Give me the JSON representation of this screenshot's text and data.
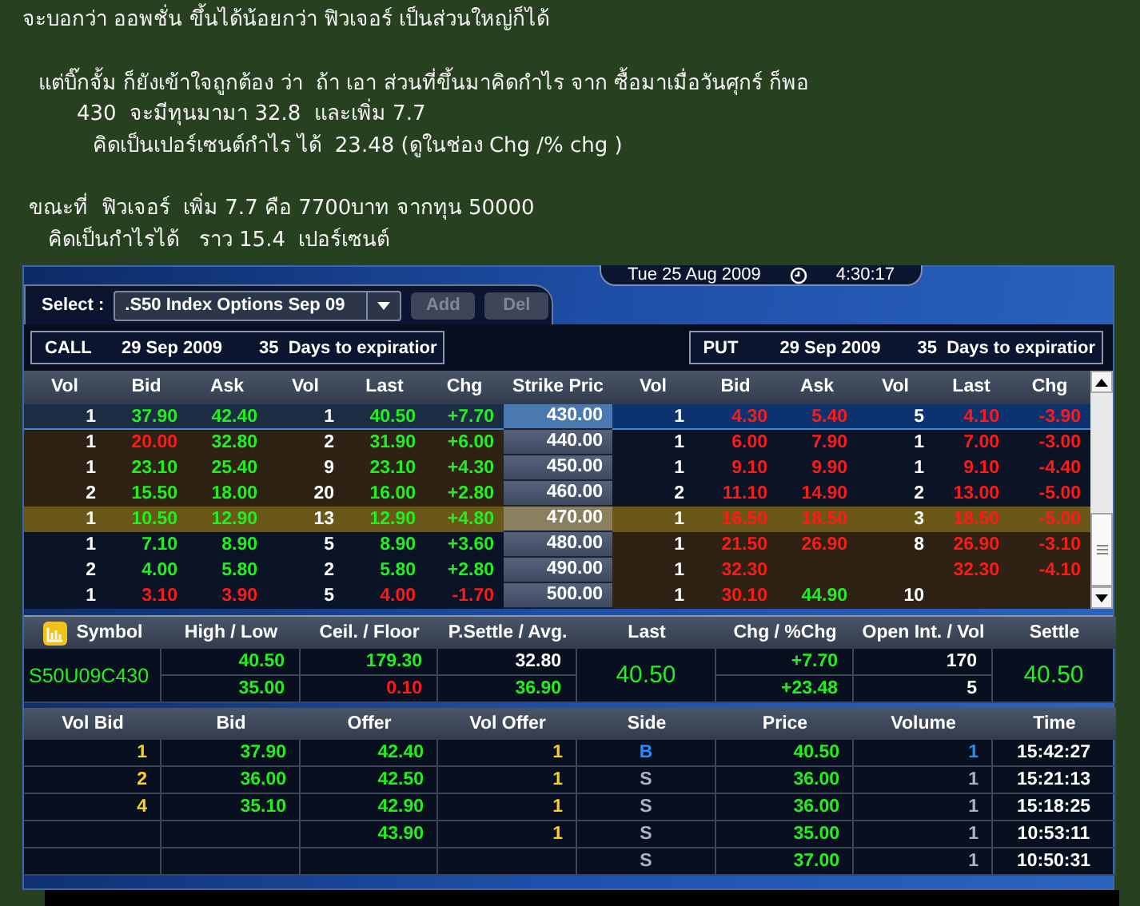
{
  "note": {
    "paragraphs": [
      {
        "lines": [
          "จะบอกว่า ออพชั่น ขึ้นได้น้อยกว่า ฟิวเจอร์ เป็นส่วนใหญ่ก็ได้"
        ]
      },
      {
        "lines": [
          "แต่บิ๊กจั้ม ก็ยังเข้าใจถูกต้อง ว่า  ถ้า เอา ส่วนที่ขึ้นมาคิดกำไร จาก ซื้อมาเมื่อวันศุกร์ ก็พอ",
          "430  จะมีทุนมามา 32.8  และเพิ่ม 7.7",
          "คิดเป็นเปอร์เซนต์กำไร ได้  23.48 (ดูในช่อง Chg /% chg )"
        ]
      },
      {
        "lines": [
          "ขณะที่  ฟิวเจอร์  เพิ่ม 7.7 คือ 7700บาท จากทุน 50000",
          "คิดเป็นกำไรได้   ราว 15.4  เปอร์เซนต์"
        ]
      }
    ]
  },
  "app": {
    "select_label": "Select :",
    "select_value": ".S50 Index Options Sep 09",
    "buttons": [
      {
        "label": "Add",
        "disabled": true
      },
      {
        "label": "Del",
        "disabled": true
      }
    ],
    "date": "Tue 25 Aug 2009",
    "time": "4:30:17",
    "call_bar": {
      "side": "CALL",
      "date": "29 Sep 2009",
      "days": "35  Days to expiratior"
    },
    "put_bar": {
      "side": "PUT",
      "date": "29 Sep 2009",
      "days": "35  Days to expiratior"
    },
    "chain": {
      "columns": [
        "Vol",
        "Bid",
        "Ask",
        "Vol",
        "Last",
        "Chg",
        "Strike Pric",
        "Vol",
        "Bid",
        "Ask",
        "Vol",
        "Last",
        "Chg"
      ],
      "rows": [
        {
          "selected": true,
          "at_the_money": false,
          "call_in_the_money": true,
          "put_in_the_money": false,
          "strike": "430.00",
          "call": {
            "vol": "1",
            "bid": {
              "text": "37.90",
              "down": false
            },
            "ask": {
              "text": "42.40",
              "down": false
            },
            "vol_2": "1",
            "last": {
              "text": "40.50",
              "down": false
            },
            "chg": {
              "text": "+7.70",
              "down": false
            }
          },
          "put": {
            "vol": "1",
            "bid": {
              "text": "4.30",
              "down": true
            },
            "ask": {
              "text": "5.40",
              "down": true
            },
            "vol_2": "5",
            "last": {
              "text": "4.10",
              "down": true
            },
            "chg": {
              "text": "-3.90",
              "down": true
            }
          }
        },
        {
          "selected": false,
          "at_the_money": false,
          "call_in_the_money": true,
          "put_in_the_money": false,
          "strike": "440.00",
          "call": {
            "vol": "1",
            "bid": {
              "text": "20.00",
              "down": true
            },
            "ask": {
              "text": "32.80",
              "down": false
            },
            "vol_2": "2",
            "last": {
              "text": "31.90",
              "down": false
            },
            "chg": {
              "text": "+6.00",
              "down": false
            }
          },
          "put": {
            "vol": "1",
            "bid": {
              "text": "6.00",
              "down": true
            },
            "ask": {
              "text": "7.90",
              "down": true
            },
            "vol_2": "1",
            "last": {
              "text": "7.00",
              "down": true
            },
            "chg": {
              "text": "-3.00",
              "down": true
            }
          }
        },
        {
          "selected": false,
          "at_the_money": false,
          "call_in_the_money": true,
          "put_in_the_money": false,
          "strike": "450.00",
          "call": {
            "vol": "1",
            "bid": {
              "text": "23.10",
              "down": false
            },
            "ask": {
              "text": "25.40",
              "down": false
            },
            "vol_2": "9",
            "last": {
              "text": "23.10",
              "down": false
            },
            "chg": {
              "text": "+4.30",
              "down": false
            }
          },
          "put": {
            "vol": "1",
            "bid": {
              "text": "9.10",
              "down": true
            },
            "ask": {
              "text": "9.90",
              "down": true
            },
            "vol_2": "1",
            "last": {
              "text": "9.10",
              "down": true
            },
            "chg": {
              "text": "-4.40",
              "down": true
            }
          }
        },
        {
          "selected": false,
          "at_the_money": false,
          "call_in_the_money": true,
          "put_in_the_money": false,
          "strike": "460.00",
          "call": {
            "vol": "2",
            "bid": {
              "text": "15.50",
              "down": false
            },
            "ask": {
              "text": "18.00",
              "down": false
            },
            "vol_2": "20",
            "last": {
              "text": "16.00",
              "down": false
            },
            "chg": {
              "text": "+2.80",
              "down": false
            }
          },
          "put": {
            "vol": "2",
            "bid": {
              "text": "11.10",
              "down": true
            },
            "ask": {
              "text": "14.90",
              "down": true
            },
            "vol_2": "2",
            "last": {
              "text": "13.00",
              "down": true
            },
            "chg": {
              "text": "-5.00",
              "down": true
            }
          }
        },
        {
          "selected": false,
          "at_the_money": true,
          "call_in_the_money": false,
          "put_in_the_money": false,
          "strike": "470.00",
          "call": {
            "vol": "1",
            "bid": {
              "text": "10.50",
              "down": false
            },
            "ask": {
              "text": "12.90",
              "down": false
            },
            "vol_2": "13",
            "last": {
              "text": "12.90",
              "down": false
            },
            "chg": {
              "text": "+4.80",
              "down": false
            }
          },
          "put": {
            "vol": "1",
            "bid": {
              "text": "16.50",
              "down": true
            },
            "ask": {
              "text": "18.50",
              "down": true
            },
            "vol_2": "3",
            "last": {
              "text": "18.50",
              "down": true
            },
            "chg": {
              "text": "-5.00",
              "down": true
            }
          }
        },
        {
          "selected": false,
          "at_the_money": false,
          "call_in_the_money": false,
          "put_in_the_money": true,
          "strike": "480.00",
          "call": {
            "vol": "1",
            "bid": {
              "text": "7.10",
              "down": false
            },
            "ask": {
              "text": "8.90",
              "down": false
            },
            "vol_2": "5",
            "last": {
              "text": "8.90",
              "down": false
            },
            "chg": {
              "text": "+3.60",
              "down": false
            }
          },
          "put": {
            "vol": "1",
            "bid": {
              "text": "21.50",
              "down": true
            },
            "ask": {
              "text": "26.90",
              "down": true
            },
            "vol_2": "8",
            "last": {
              "text": "26.90",
              "down": true
            },
            "chg": {
              "text": "-3.10",
              "down": true
            }
          }
        },
        {
          "selected": false,
          "at_the_money": false,
          "call_in_the_money": false,
          "put_in_the_money": true,
          "strike": "490.00",
          "call": {
            "vol": "2",
            "bid": {
              "text": "4.00",
              "down": false
            },
            "ask": {
              "text": "5.80",
              "down": false
            },
            "vol_2": "2",
            "last": {
              "text": "5.80",
              "down": false
            },
            "chg": {
              "text": "+2.80",
              "down": false
            }
          },
          "put": {
            "vol": "1",
            "bid": {
              "text": "32.30",
              "down": true
            },
            "last": {
              "text": "32.30",
              "down": true
            },
            "chg": {
              "text": "-4.10",
              "down": true
            }
          }
        },
        {
          "selected": false,
          "at_the_money": false,
          "call_in_the_money": false,
          "put_in_the_money": true,
          "strike": "500.00",
          "call": {
            "vol": "1",
            "bid": {
              "text": "3.10",
              "down": true
            },
            "ask": {
              "text": "3.90",
              "down": true
            },
            "vol_2": "5",
            "last": {
              "text": "4.00",
              "down": true
            },
            "chg": {
              "text": "-1.70",
              "down": true
            }
          },
          "put": {
            "vol": "1",
            "bid": {
              "text": "30.10",
              "down": true
            },
            "ask": {
              "text": "44.90",
              "down": false
            },
            "vol_2": "10"
          }
        }
      ]
    },
    "quote": {
      "columns": [
        "Symbol",
        "High / Low",
        "Ceil. / Floor",
        "P.Settle / Avg.",
        "Last",
        "Chg / %Chg",
        "Open Int. / Vol",
        "Settle"
      ],
      "cells": [
        {
          "lines": [
            {
              "text": "S50U09C430",
              "up": true,
              "down": false
            }
          ]
        },
        {
          "lines": [
            {
              "text": "40.50",
              "up": true,
              "down": false
            },
            {
              "text": "35.00",
              "up": true,
              "down": false
            }
          ]
        },
        {
          "lines": [
            {
              "text": "179.30",
              "up": true,
              "down": false
            },
            {
              "text": "0.10",
              "up": false,
              "down": true
            }
          ]
        },
        {
          "lines": [
            {
              "text": "32.80",
              "up": false,
              "down": false
            },
            {
              "text": "36.90",
              "up": true,
              "down": false
            }
          ]
        },
        {
          "lines": [
            {
              "text": "40.50",
              "up": true,
              "down": false
            }
          ]
        },
        {
          "lines": [
            {
              "text": "+7.70",
              "up": true,
              "down": false
            },
            {
              "text": "+23.48",
              "up": true,
              "down": false
            }
          ]
        },
        {
          "lines": [
            {
              "text": "170",
              "up": false,
              "down": false
            },
            {
              "text": "5",
              "up": false,
              "down": false
            }
          ]
        },
        {
          "lines": [
            {
              "text": "40.50",
              "up": true,
              "down": false
            }
          ]
        }
      ]
    },
    "trades": {
      "columns": [
        "Vol Bid",
        "Bid",
        "Offer",
        "Vol Offer",
        "Side",
        "Price",
        "Volume",
        "Time"
      ],
      "rows": [
        {
          "buy": true,
          "cells": {
            "vol_bid": "1",
            "bid": "37.90",
            "offer": "42.40",
            "vol_offer": "1",
            "side": "B",
            "price": "40.50",
            "volume": "1",
            "time": "15:42:27"
          }
        },
        {
          "buy": false,
          "cells": {
            "vol_bid": "2",
            "bid": "36.00",
            "offer": "42.50",
            "vol_offer": "1",
            "side": "S",
            "price": "36.00",
            "volume": "1",
            "time": "15:21:13"
          }
        },
        {
          "buy": false,
          "cells": {
            "vol_bid": "4",
            "bid": "35.10",
            "offer": "42.90",
            "vol_offer": "1",
            "side": "S",
            "price": "36.00",
            "volume": "1",
            "time": "15:18:25"
          }
        },
        {
          "buy": false,
          "cells": {
            "offer": "43.90",
            "vol_offer": "1",
            "side": "S",
            "price": "35.00",
            "volume": "1",
            "time": "10:53:11"
          }
        },
        {
          "buy": false,
          "cells": {
            "side": "S",
            "price": "37.00",
            "volume": "1",
            "time": "10:50:31"
          }
        }
      ]
    }
  }
}
